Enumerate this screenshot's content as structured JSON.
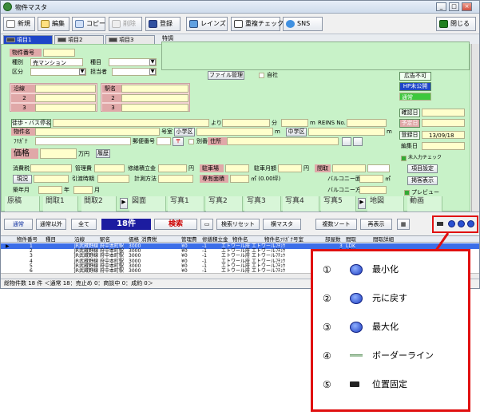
{
  "window": {
    "title": "物件マスタ",
    "controls": [
      "_",
      "□",
      "×"
    ]
  },
  "toolbar": {
    "buttons": [
      "新規",
      "編集",
      "コピー",
      "削除",
      "登録",
      "レインズ",
      "重複チェック",
      "SNS"
    ],
    "close": "閉じる"
  },
  "tabs": [
    "項目1",
    "項目2",
    "項目3"
  ],
  "tab_extra": {
    "label": "特調"
  },
  "form": {
    "bukken_no": "物件番号",
    "shubetsu": "種別",
    "shubetsu_value": "売マンション",
    "shumoku": "種目",
    "kubun": "区分",
    "tantousha": "担当者",
    "file_btn": "ファイル管理",
    "jisha": "自社",
    "ensen": "沿線",
    "ekimei": "駅名",
    "row2": "2",
    "row3": "3",
    "tokuho_btn": "徒歩・バス停名",
    "yori": "より",
    "fun": "分",
    "m": "m",
    "reins_no": "REINS No.",
    "bukken_mei": "物件名",
    "gouto": "号室",
    "shogakku": "小学区",
    "chugakku": "中学区",
    "furigana": "ﾌﾘｶﾞﾅ",
    "yubin": "郵便番号",
    "yubin_mark": "〒",
    "betsumei": "別番",
    "jusho": "住所",
    "kakaku": "価格",
    "manen": "万円",
    "rireki": "履歴",
    "shohizei": "消費税",
    "kanrihi": "管理費",
    "shuzen": "修繕積立金",
    "en": "円",
    "chushajo": "駐車場",
    "chusha_getsu": "駐車月額",
    "madori": "間取",
    "genkyo": "現況",
    "hikiwatashi": "引渡時期",
    "keisoku": "計測方法",
    "senyu": "専有面積",
    "m2_note": "㎡ (0.00坪)",
    "balcony_men": "バルコニー面積",
    "balcony_ho": "バルコニー方向",
    "m2": "㎡",
    "chikunen": "築年月",
    "nen": "年",
    "tsuki": "月",
    "right_buttons": [
      "広告不可",
      "HP未公開",
      "通常"
    ],
    "kakunin": "確認日",
    "yotei": "予定日",
    "touroku": "登録日",
    "touroku_value": "13/09/18",
    "henshu": "編集日",
    "mirai_check": "未入力チェック",
    "koumoku_settei": "項目設定",
    "kakusha": "掲客表示",
    "preview": "プレビュー",
    "photo_tabs": [
      "原稿",
      "間取1",
      "間取2",
      "図面",
      "写真1",
      "写真2",
      "写真3",
      "写真4",
      "写真5",
      "地図",
      "動画"
    ]
  },
  "lower_toolbar": {
    "buttons": [
      "通常",
      "通常以外",
      "全て"
    ],
    "count": "18件",
    "search": "検索",
    "reset": "検索リセット",
    "column": "横マスタ",
    "sort": "複数ソート",
    "redisplay": "再表示"
  },
  "grid": {
    "headers": [
      "物件番号",
      "種目",
      "沿線",
      "駅名",
      "価格",
      "消費税",
      "管理費",
      "修繕積立金",
      "物件名",
      "物件名ﾌﾘｶﾞﾅ",
      "号室",
      "部屋数",
      "間取",
      "間取詳細"
    ],
    "rows": [
      {
        "no": "1",
        "line": "JR武蔵野線",
        "station": "府中本町駅",
        "price": "3000",
        "kanri": "¥0",
        "shuzen": "-1",
        "name": "エトワール府",
        "kana": "エトワールﾌﾁｭｳ",
        "rooms": "3",
        "madori": "LDK"
      },
      {
        "no": "2",
        "line": "JR武蔵野線",
        "station": "府中本町駅",
        "price": "3000",
        "kanri": "¥0",
        "shuzen": "-1",
        "name": "エトワール府",
        "kana": "エトワールﾌﾁｭｳ",
        "rooms": "3",
        "madori": "LDK"
      },
      {
        "no": "3",
        "line": "JR武蔵野線",
        "station": "府中本町駅",
        "price": "3000",
        "kanri": "¥0",
        "shuzen": "-1",
        "name": "エトワール府",
        "kana": "エトワールﾌﾁｭｳ",
        "rooms": "3",
        "madori": "LDK"
      },
      {
        "no": "4",
        "line": "JR武蔵野線",
        "station": "府中本町駅",
        "price": "3000",
        "kanri": "¥0",
        "shuzen": "-1",
        "name": "エトワール府",
        "kana": "エトワールﾌﾁｭｳ",
        "rooms": "3",
        "madori": "LDK"
      },
      {
        "no": "5",
        "line": "JR武蔵野線",
        "station": "府中本町駅",
        "price": "3000",
        "kanri": "¥0",
        "shuzen": "-1",
        "name": "エトワール府",
        "kana": "エトワールﾌﾁｭｳ",
        "rooms": "3",
        "madori": "LDK"
      },
      {
        "no": "6",
        "line": "JR武蔵野線",
        "station": "府中本町駅",
        "price": "3000",
        "kanri": "¥0",
        "shuzen": "-1",
        "name": "エトワール府",
        "kana": "エトワールﾌﾁｭｳ",
        "rooms": "3",
        "madori": "LDK"
      }
    ]
  },
  "status": "総物件数 18 件 ＜通常 18：売止め 0：商談中 0：成約 0＞",
  "callout": {
    "items": [
      {
        "num": "①",
        "label": "最小化",
        "icon": "minimize-icon"
      },
      {
        "num": "②",
        "label": "元に戻す",
        "icon": "restore-icon"
      },
      {
        "num": "③",
        "label": "最大化",
        "icon": "maximize-icon"
      },
      {
        "num": "④",
        "label": "ボーダーライン",
        "icon": "borderline-icon"
      },
      {
        "num": "⑤",
        "label": "位置固定",
        "icon": "pin-icon"
      }
    ]
  }
}
